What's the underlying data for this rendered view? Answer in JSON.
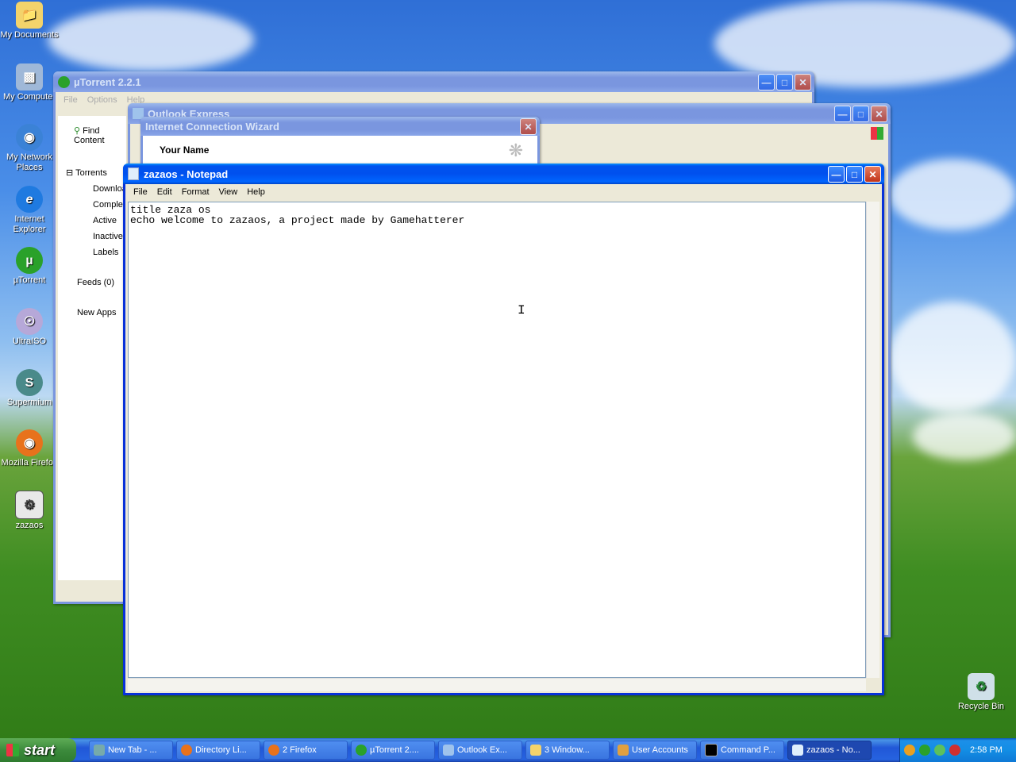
{
  "desktop": {
    "icons": [
      {
        "label": "My Documents"
      },
      {
        "label": "My Computer"
      },
      {
        "label": "My Network Places"
      },
      {
        "label": "Internet Explorer"
      },
      {
        "label": "µTorrent"
      },
      {
        "label": "UltraISO"
      },
      {
        "label": "Supermium"
      },
      {
        "label": "Mozilla Firefox"
      },
      {
        "label": "zazaos"
      }
    ],
    "recycle_bin": "Recycle Bin"
  },
  "utorrent": {
    "title": "µTorrent 2.2.1",
    "menu": [
      "File",
      "Options",
      "Help"
    ],
    "find_content": "Find Content",
    "tree": [
      "Torrents",
      "Downloading",
      "Completed",
      "Active",
      "Inactive",
      "Labels",
      "Feeds (0)",
      "New Apps"
    ]
  },
  "outlook": {
    "title": "Outlook Express"
  },
  "wizard": {
    "title": "Internet Connection Wizard",
    "heading": "Your Name"
  },
  "notepad": {
    "title": "zazaos - Notepad",
    "menu": [
      "File",
      "Edit",
      "Format",
      "View",
      "Help"
    ],
    "lines": [
      "title zaza os",
      "echo welcome to zazaos, a project made by Gamehatterer"
    ]
  },
  "taskbar": {
    "start": "start",
    "tasks": [
      {
        "label": "New Tab - ..."
      },
      {
        "label": "Directory Li..."
      },
      {
        "label": "2 Firefox"
      },
      {
        "label": "µTorrent 2...."
      },
      {
        "label": "Outlook Ex..."
      },
      {
        "label": "3 Window..."
      },
      {
        "label": "User Accounts"
      },
      {
        "label": "Command P..."
      },
      {
        "label": "zazaos - No..."
      }
    ],
    "clock": "2:58 PM"
  },
  "colors": {
    "titlebar_active": "#0053ee",
    "titlebar_inactive": "#7a96df",
    "start_green": "#3c8b3c"
  }
}
